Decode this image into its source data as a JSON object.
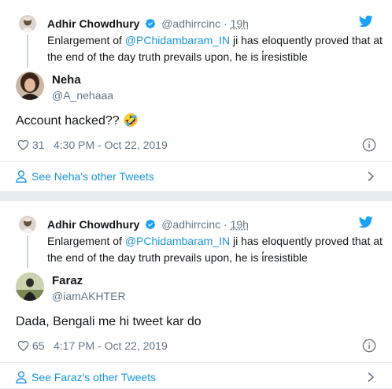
{
  "tweets": [
    {
      "parent": {
        "name": "Adhir Chowdhury",
        "handle": "@adhirrcinc",
        "separator": "·",
        "age": "19h",
        "text_before": "Enlargement of ",
        "mention": "@PChidambaram_IN",
        "text_after": " ji has eloquently proved that at the end of the day truth prevails upon, he is i̇́resistible"
      },
      "reply": {
        "name": "Neha",
        "handle": "@A_nehaaa",
        "text": "Account hacked?? 🤣",
        "likes": "31",
        "timestamp": "4:30 PM - Oct 22, 2019"
      },
      "see_more": "See Neha's other Tweets"
    },
    {
      "parent": {
        "name": "Adhir Chowdhury",
        "handle": "@adhirrcinc",
        "separator": "·",
        "age": "19h",
        "text_before": "Enlargement of ",
        "mention": "@PChidambaram_IN",
        "text_after": " ji has eloquently proved that at the end of the day truth prevails upon, he is i̇́resistible"
      },
      "reply": {
        "name": "Faraz",
        "handle": "@iamAKHTER",
        "text": "Dada, Bengali me hi tweet kar do",
        "likes": "65",
        "timestamp": "4:17 PM - Oct 22, 2019"
      },
      "see_more": "See Faraz's other Tweets"
    }
  ],
  "colors": {
    "link": "#1b95e0",
    "verified": "#1da1f2",
    "muted": "#657786",
    "border": "#e1e8ed"
  },
  "icons": [
    "verified-badge-icon",
    "twitter-bird-icon",
    "heart-icon",
    "info-icon",
    "person-icon",
    "chevron-right-icon"
  ]
}
